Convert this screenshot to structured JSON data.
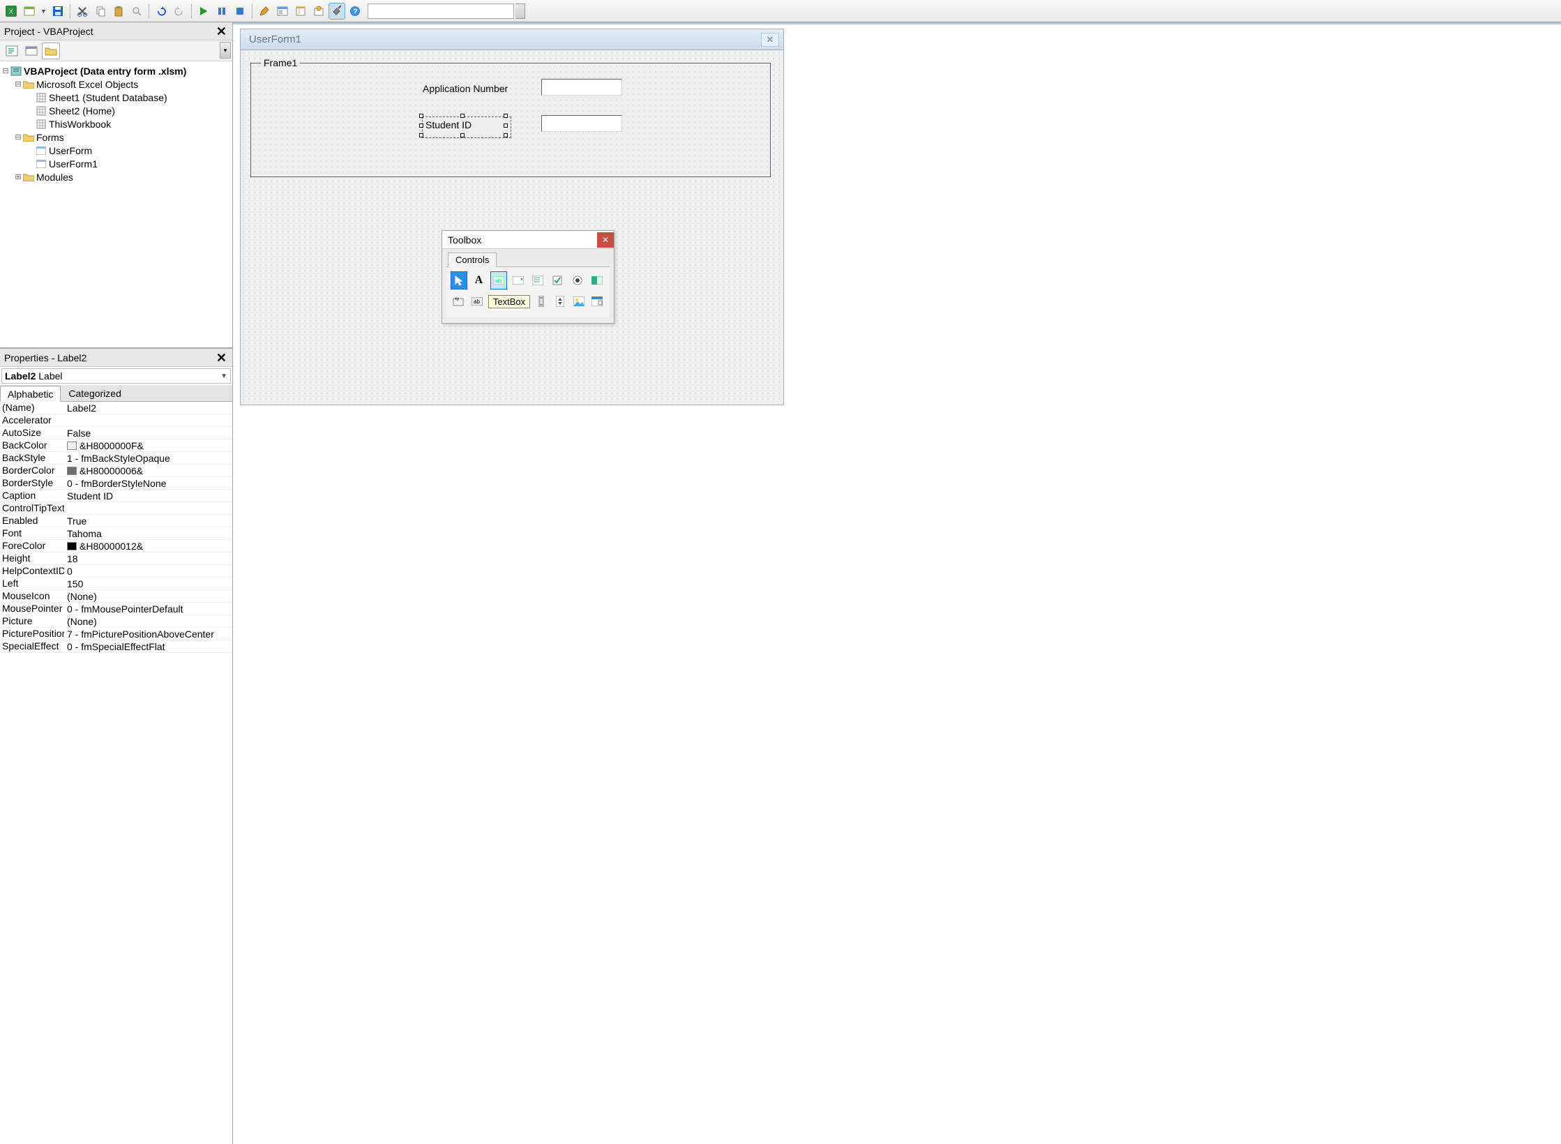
{
  "toolbar": {
    "combo_value": ""
  },
  "project_panel": {
    "title": "Project - VBAProject",
    "root": "VBAProject (Data entry form .xlsm)",
    "excel_objects": "Microsoft Excel Objects",
    "sheet1": "Sheet1 (Student Database)",
    "sheet2": "Sheet2 (Home)",
    "thisworkbook": "ThisWorkbook",
    "forms_folder": "Forms",
    "userform": "UserForm",
    "userform1": "UserForm1",
    "modules_folder": "Modules"
  },
  "properties_panel": {
    "title": "Properties - Label2",
    "object_select": "Label2 Label",
    "tab_alpha": "Alphabetic",
    "tab_cat": "Categorized",
    "rows": [
      {
        "name": "(Name)",
        "value": "Label2"
      },
      {
        "name": "Accelerator",
        "value": ""
      },
      {
        "name": "AutoSize",
        "value": "False"
      },
      {
        "name": "BackColor",
        "value": "&H8000000F&",
        "chip": "#efefef"
      },
      {
        "name": "BackStyle",
        "value": "1 - fmBackStyleOpaque"
      },
      {
        "name": "BorderColor",
        "value": "&H80000006&",
        "chip": "#6e6e6e"
      },
      {
        "name": "BorderStyle",
        "value": "0 - fmBorderStyleNone"
      },
      {
        "name": "Caption",
        "value": "Student ID"
      },
      {
        "name": "ControlTipText",
        "value": ""
      },
      {
        "name": "Enabled",
        "value": "True"
      },
      {
        "name": "Font",
        "value": "Tahoma"
      },
      {
        "name": "ForeColor",
        "value": "&H80000012&",
        "chip": "#000000"
      },
      {
        "name": "Height",
        "value": "18"
      },
      {
        "name": "HelpContextID",
        "value": "0"
      },
      {
        "name": "Left",
        "value": "150"
      },
      {
        "name": "MouseIcon",
        "value": "(None)"
      },
      {
        "name": "MousePointer",
        "value": "0 - fmMousePointerDefault"
      },
      {
        "name": "Picture",
        "value": "(None)"
      },
      {
        "name": "PicturePosition",
        "value": "7 - fmPicturePositionAboveCenter"
      },
      {
        "name": "SpecialEffect",
        "value": "0 - fmSpecialEffectFlat"
      }
    ]
  },
  "designer": {
    "form_title": "UserForm1",
    "frame_caption": "Frame1",
    "label_app_number": "Application Number",
    "label_student_id": "Student ID"
  },
  "toolbox": {
    "title": "Toolbox",
    "tab": "Controls",
    "tooltip": "TextBox"
  }
}
